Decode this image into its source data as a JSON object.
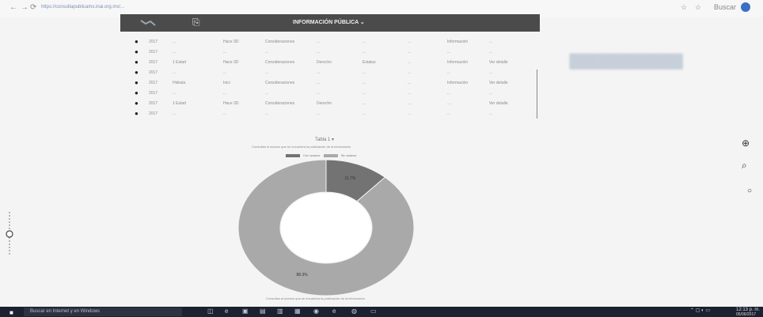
{
  "browser": {
    "url": "https://consultapublicamx.inai.org.mx/...",
    "account_label": "Buscar"
  },
  "nav": {
    "title": "INFORMACIÓN PÚBLICA ⌄"
  },
  "table": {
    "rows": [
      [
        "2017",
        "...",
        "Hace 3D",
        "Consideraciones",
        "...",
        "...",
        "...",
        "Información",
        "..."
      ],
      [
        "2017",
        "...",
        "...",
        "...",
        "...",
        "...",
        "...",
        "...",
        "..."
      ],
      [
        "2017",
        "1 Estad",
        "Hace 3D",
        "Consideraciones",
        "Derecho",
        "Estatus",
        "...",
        "Información",
        "Ver detalle"
      ],
      [
        "2017",
        "...",
        "...",
        "...",
        "...",
        "...",
        "...",
        "...",
        "..."
      ],
      [
        "2017",
        "Hidrata",
        "Inici",
        "Consideraciones",
        "...",
        "...",
        "...",
        "Información",
        "Ver detalle"
      ],
      [
        "2017",
        "...",
        "...",
        "...",
        "...",
        "...",
        "...",
        "...",
        "..."
      ],
      [
        "2017",
        "1 Estad",
        "Hace 3D",
        "Consideraciones",
        "Derecho",
        "...",
        "...",
        "...",
        "Ver detalle"
      ],
      [
        "2017",
        "...",
        "...",
        "...",
        "...",
        "...",
        "...",
        "...",
        "..."
      ]
    ]
  },
  "chart": {
    "title": "Tabla 1 ▾",
    "subtitle": "Consultas al avance que se encuentra la publicación de la información",
    "legend": [
      "Con avance",
      "Sin avance"
    ],
    "footer": "Consultas al avance que se encuentra la publicación de la información"
  },
  "chart_data": {
    "type": "pie",
    "categories": [
      "Con avance",
      "Sin avance"
    ],
    "values": [
      11.7,
      88.3
    ],
    "labels": [
      "11.7%",
      "88.3%"
    ],
    "colors": [
      "#737373",
      "#a9a9a9"
    ]
  },
  "taskbar": {
    "search_text": "Buscar en Internet y en Windows",
    "time": "12:13 p. m.",
    "date": "05/06/2017"
  }
}
